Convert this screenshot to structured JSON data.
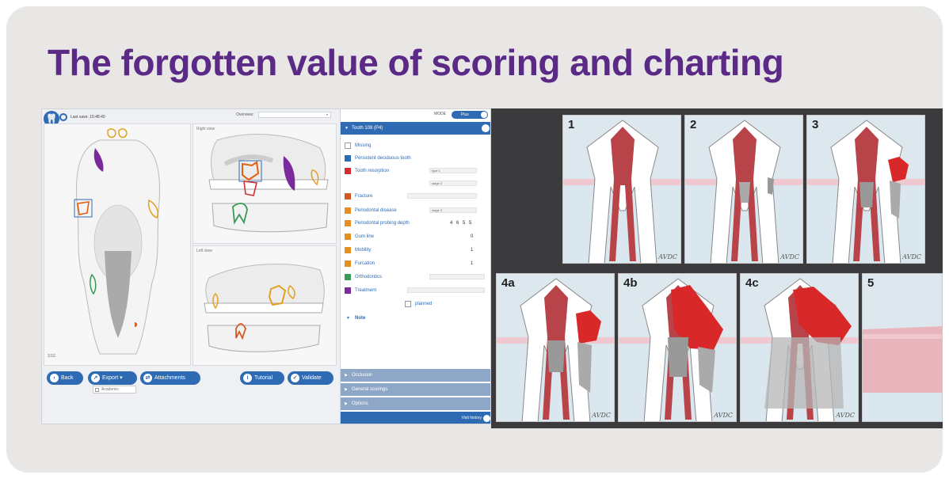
{
  "headline": "The forgotten value of scoring and charting",
  "app": {
    "last_save": "Last save: 15:48:40",
    "overview_label": "Overview:",
    "mode_label": "MODE",
    "mode_value": "Plus",
    "panes": {
      "right_view": "Right view",
      "left_view": "Left view",
      "skull_code": "SSS"
    },
    "buttons": {
      "back": "Back",
      "export": "Export",
      "attachments": "Attachments",
      "tutorial": "Tutorial",
      "validate": "Validate",
      "academic": "Academic"
    },
    "tooth_panel": {
      "header": "Tooth 108 (P4)",
      "items": [
        "Missing",
        "Persistent deciduous tooth",
        "Tooth resorption",
        "Fracture",
        "Periodontal disease",
        "Periodontal probing depth",
        "Gum line",
        "Mobility",
        "Furcation",
        "Orthodontics",
        "Treatment"
      ],
      "resorption_type": "type 1",
      "resorption_stage": "stage 2",
      "periodontal_stage": "stage 3",
      "probing_values": [
        "4",
        "6",
        "5",
        "5"
      ],
      "gum_line_value": "0",
      "mobility_value": "1",
      "furcation_value": "1",
      "treatment_option": "planned",
      "note_label": "Note",
      "collapsed_sections": [
        "Occlusion",
        "General scorings",
        "Options"
      ],
      "visit_history": "Visit history"
    }
  },
  "stages": {
    "labels": [
      "1",
      "2",
      "3",
      "4a",
      "4b",
      "4c",
      "5"
    ],
    "brand": "AVDC"
  },
  "colors": {
    "headline": "#5a2a86",
    "app_blue": "#2f6bb3",
    "pulp_red": "#b8444a",
    "lesion_red": "#d8282a",
    "bone": "#dde8ee"
  }
}
